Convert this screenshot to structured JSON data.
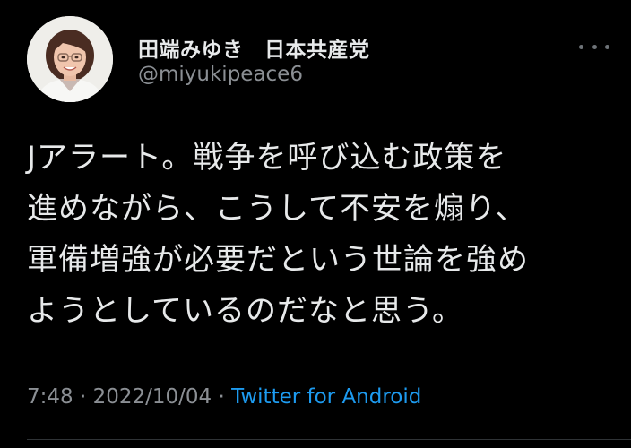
{
  "user": {
    "display_name": "田端みゆき　日本共産党",
    "handle": "@miyukipeace6"
  },
  "tweet": {
    "lines": [
      "Jアラート。戦争を呼び込む政策を",
      "進めながら、こうして不安を煽り、",
      "軍備増強が必要だという世論を強め",
      "ようとしているのだなと思う。"
    ]
  },
  "meta": {
    "time": "7:48",
    "separator": " · ",
    "date": "2022/10/04",
    "source": "Twitter for Android"
  },
  "icons": {
    "more": "more-horizontal-icon"
  },
  "colors": {
    "background": "#000000",
    "text_primary": "#e7e9ea",
    "text_secondary": "#8b8f94",
    "link": "#1d9bf0"
  }
}
